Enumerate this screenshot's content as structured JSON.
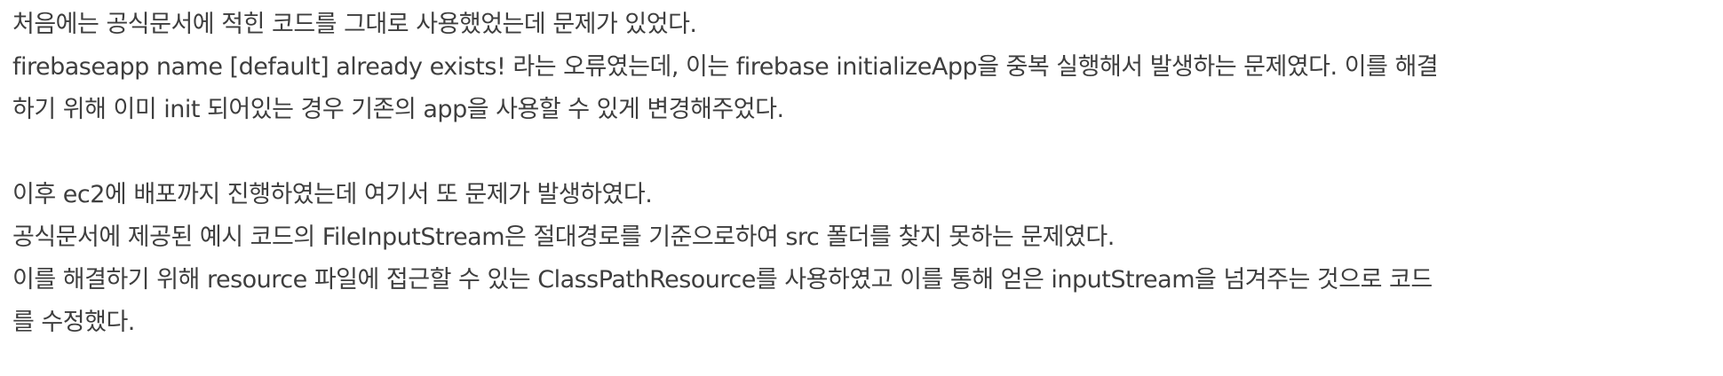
{
  "document": {
    "section1": {
      "line1": "처음에는 공식문서에 적힌 코드를 그대로 사용했었는데 문제가 있었다.",
      "line2": "firebaseapp name [default] already exists! 라는 오류였는데, 이는 firebase initializeApp을 중복 실행해서 발생하는 문제였다. 이를 해결",
      "line3": "하기 위해 이미 init 되어있는 경우 기존의 app을 사용할 수 있게 변경해주었다."
    },
    "section2": {
      "line1": "이후 ec2에 배포까지 진행하였는데 여기서 또 문제가 발생하였다.",
      "line2": "공식문서에 제공된 예시 코드의 FileInputStream은 절대경로를 기준으로하여 src 폴더를 찾지 못하는 문제였다.",
      "line3": "이를 해결하기 위해 resource 파일에 접근할 수 있는 ClassPathResource를 사용하였고 이를 통해 얻은 inputStream을 넘겨주는 것으로 코드",
      "line4": "를 수정했다."
    }
  }
}
